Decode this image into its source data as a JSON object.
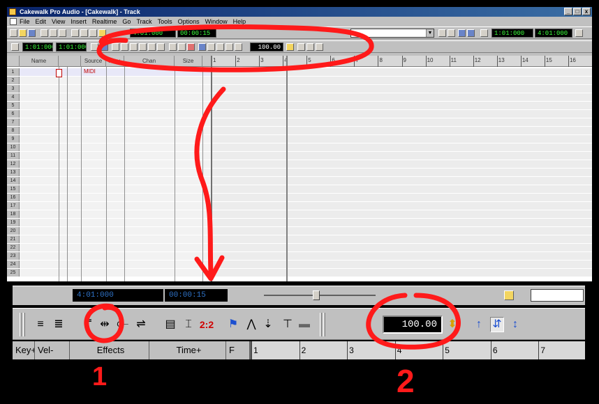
{
  "window": {
    "title": "Cakewalk Pro Audio - [Cakewalk] - Track",
    "controls": [
      "_",
      "□",
      "x"
    ]
  },
  "menubar": [
    "File",
    "Edit",
    "View",
    "Insert",
    "Realtime",
    "Go",
    "Track",
    "Tools",
    "Options",
    "Window",
    "Help"
  ],
  "toolbar1": {
    "counter": "4:01:000",
    "counter2": "00:00:15",
    "right_counter": "1:01:000",
    "right_counter2": "4:01:000"
  },
  "toolbar2": {
    "left_counter": "1:01:000",
    "left_counter2": "1:01:000",
    "tempo": "100.00"
  },
  "track_columns": [
    "Name",
    "Source",
    "Key+",
    "Chan",
    "Size"
  ],
  "ruler_marks": [
    "1",
    "2",
    "3",
    "4",
    "5",
    "6",
    "7",
    "8",
    "9",
    "10",
    "11",
    "12",
    "13",
    "14",
    "15",
    "16"
  ],
  "track_numbers": [
    "1",
    "2",
    "3",
    "4",
    "5",
    "6",
    "7",
    "8",
    "9",
    "10",
    "11",
    "12",
    "13",
    "14",
    "15",
    "16",
    "17",
    "18",
    "19",
    "20",
    "21",
    "22",
    "23",
    "24",
    "25"
  ],
  "track1_source": "MIDI",
  "zoomed": {
    "counter_left": "4:01:000",
    "counter_left2": "00:00:15",
    "tempo": "100.00",
    "labels_2_2": "2:2",
    "headers": [
      "Key+",
      "Vel-",
      "Effects",
      "Time+",
      "F"
    ],
    "ruler": [
      "1",
      "2",
      "3",
      "4",
      "5",
      "6",
      "7"
    ]
  },
  "annotations": {
    "label_one": "1",
    "label_two": "2",
    "color": "#ff1a1a"
  }
}
